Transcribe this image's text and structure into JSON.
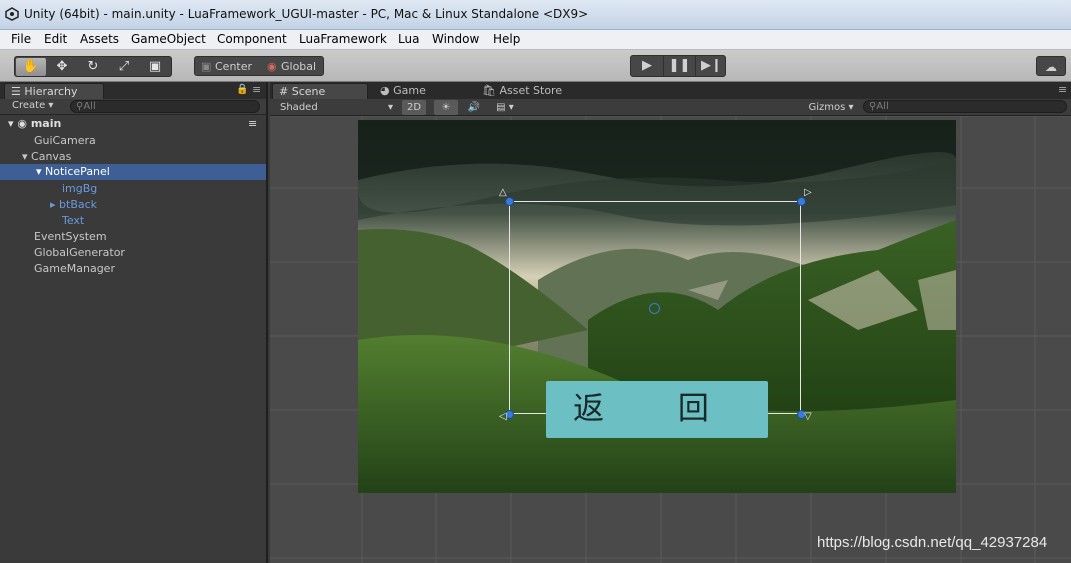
{
  "window": {
    "title": "Unity (64bit) - main.unity - LuaFramework_UGUI-master - PC, Mac & Linux Standalone <DX9>"
  },
  "menu": [
    "File",
    "Edit",
    "Assets",
    "GameObject",
    "Component",
    "LuaFramework",
    "Lua",
    "Window",
    "Help"
  ],
  "toolbar": {
    "tools": [
      "hand-icon",
      "move-icon",
      "rotate-icon",
      "scale-icon",
      "rect-icon"
    ],
    "pivot_center": "Center",
    "pivot_global": "Global"
  },
  "hierarchy": {
    "tab": "Hierarchy",
    "create": "Create",
    "search_placeholder": "All",
    "scene_name": "main",
    "items": [
      {
        "label": "GuiCamera"
      },
      {
        "label": "Canvas"
      },
      {
        "label": "NoticePanel"
      },
      {
        "label": "imgBg"
      },
      {
        "label": "btBack"
      },
      {
        "label": "Text"
      },
      {
        "label": "EventSystem"
      },
      {
        "label": "GlobalGenerator"
      },
      {
        "label": "GameManager"
      }
    ]
  },
  "scene": {
    "tabs": [
      "Scene",
      "Game",
      "Asset Store"
    ],
    "shading": "Shaded",
    "mode_2d": "2D",
    "gizmos": "Gizmos",
    "search_placeholder": "All",
    "button_text": "返 回"
  },
  "watermark": "https://blog.csdn.net/qq_42937284",
  "colors": {
    "selection": "#3e5f96",
    "button": "#6cc0c3",
    "handle": "#3a7bd5"
  }
}
